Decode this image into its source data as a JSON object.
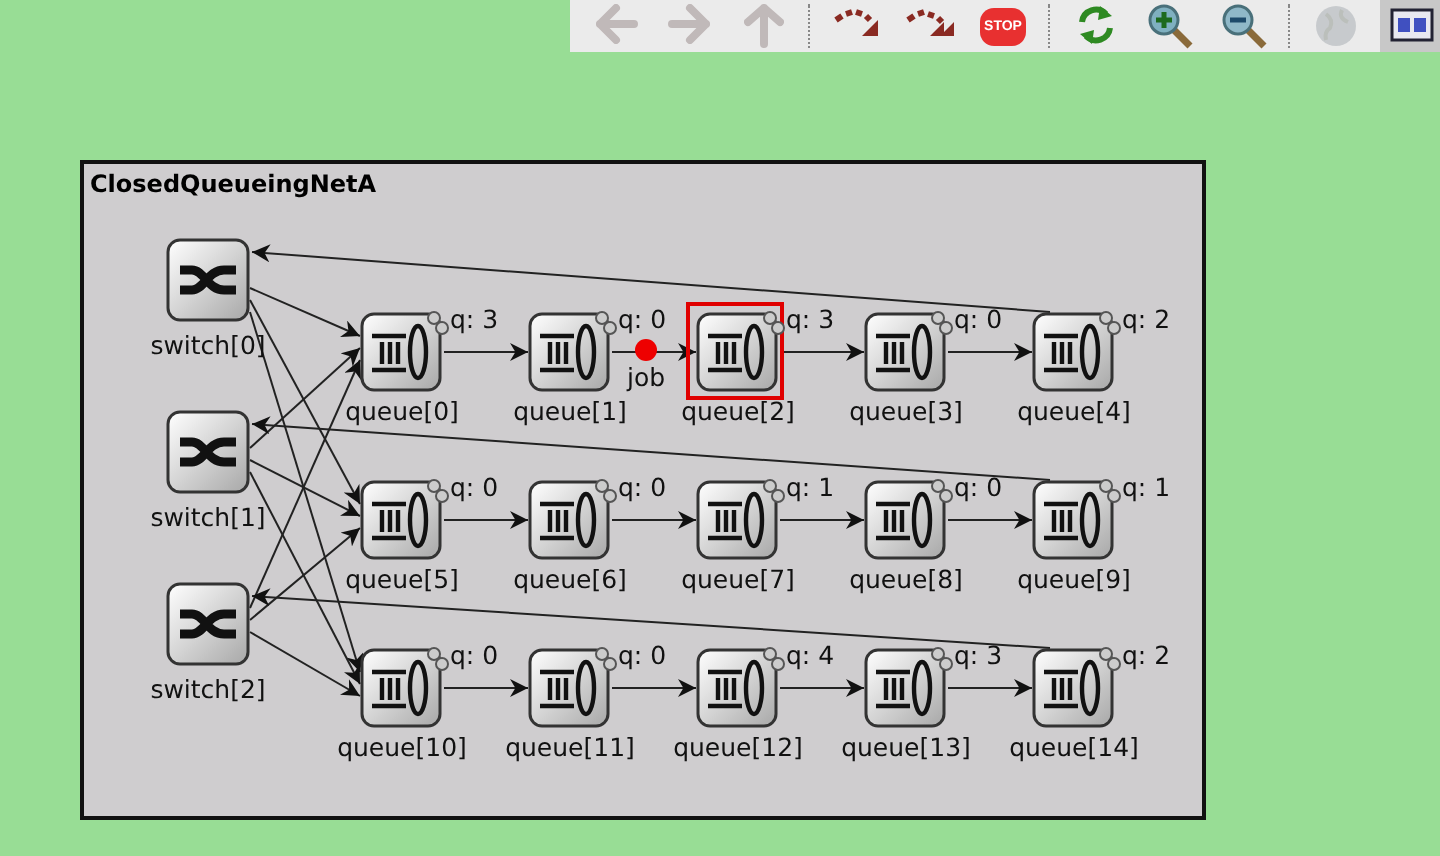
{
  "toolbar": [
    {
      "kind": "back",
      "disabled": true,
      "selected": false
    },
    {
      "kind": "forward",
      "disabled": true,
      "selected": false
    },
    {
      "kind": "up",
      "disabled": true,
      "selected": false
    },
    {
      "kind": "separator"
    },
    {
      "kind": "step",
      "disabled": false,
      "selected": false
    },
    {
      "kind": "fast",
      "disabled": false,
      "selected": false
    },
    {
      "kind": "stop",
      "label": "STOP",
      "disabled": false,
      "selected": false
    },
    {
      "kind": "separator"
    },
    {
      "kind": "refresh",
      "disabled": false,
      "selected": false
    },
    {
      "kind": "zoom-in",
      "disabled": false,
      "selected": false
    },
    {
      "kind": "zoom-out",
      "disabled": false,
      "selected": false
    },
    {
      "kind": "separator"
    },
    {
      "kind": "globe",
      "disabled": true,
      "selected": false
    },
    {
      "kind": "module",
      "disabled": false,
      "selected": true
    }
  ],
  "network": {
    "title": "ClosedQueueingNetA",
    "switches": [
      {
        "label": "switch[0]"
      },
      {
        "label": "switch[1]"
      },
      {
        "label": "switch[2]"
      }
    ],
    "queues": [
      {
        "label": "queue[0]",
        "q": "q: 3",
        "selected": false
      },
      {
        "label": "queue[1]",
        "q": "q: 0",
        "selected": false
      },
      {
        "label": "queue[2]",
        "q": "q: 3",
        "selected": true
      },
      {
        "label": "queue[3]",
        "q": "q: 0",
        "selected": false
      },
      {
        "label": "queue[4]",
        "q": "q: 2",
        "selected": false
      },
      {
        "label": "queue[5]",
        "q": "q: 0",
        "selected": false
      },
      {
        "label": "queue[6]",
        "q": "q: 0",
        "selected": false
      },
      {
        "label": "queue[7]",
        "q": "q: 1",
        "selected": false
      },
      {
        "label": "queue[8]",
        "q": "q: 0",
        "selected": false
      },
      {
        "label": "queue[9]",
        "q": "q: 1",
        "selected": false
      },
      {
        "label": "queue[10]",
        "q": "q: 0",
        "selected": false
      },
      {
        "label": "queue[11]",
        "q": "q: 0",
        "selected": false
      },
      {
        "label": "queue[12]",
        "q": "q: 4",
        "selected": false
      },
      {
        "label": "queue[13]",
        "q": "q: 3",
        "selected": false
      },
      {
        "label": "queue[14]",
        "q": "q: 2",
        "selected": false
      }
    ],
    "job": {
      "label": "job"
    }
  }
}
